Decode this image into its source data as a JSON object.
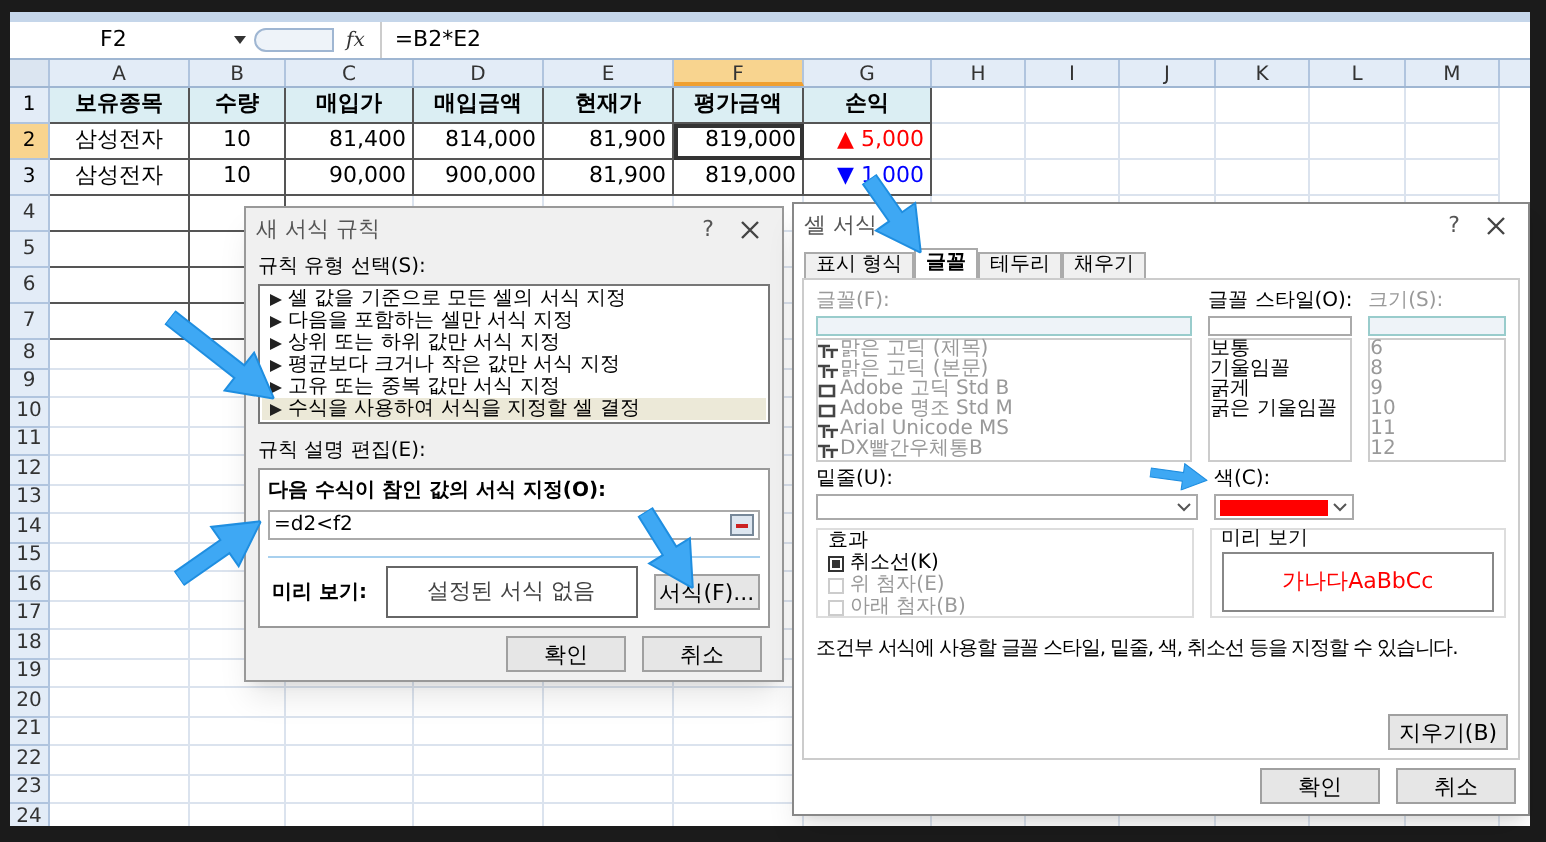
{
  "name_box": "F2",
  "function_label": "fx",
  "formula": "=B2*E2",
  "columns": [
    {
      "label": "A",
      "selected": false
    },
    {
      "label": "B",
      "selected": false
    },
    {
      "label": "C",
      "selected": false
    },
    {
      "label": "D",
      "selected": false
    },
    {
      "label": "E",
      "selected": false
    },
    {
      "label": "F",
      "selected": true
    },
    {
      "label": "G",
      "selected": false
    },
    {
      "label": "H",
      "selected": false
    },
    {
      "label": "I",
      "selected": false
    },
    {
      "label": "J",
      "selected": false
    },
    {
      "label": "K",
      "selected": false
    },
    {
      "label": "L",
      "selected": false
    },
    {
      "label": "M",
      "selected": false
    }
  ],
  "rows": [
    {
      "label": "1",
      "selected": false,
      "cells": [
        {
          "text": "보유종목",
          "kind": "header"
        },
        {
          "text": "수량",
          "kind": "header"
        },
        {
          "text": "매입가",
          "kind": "header"
        },
        {
          "text": "매입금액",
          "kind": "header"
        },
        {
          "text": "현재가",
          "kind": "header"
        },
        {
          "text": "평가금액",
          "kind": "header"
        },
        {
          "text": "손익",
          "kind": "header"
        }
      ]
    },
    {
      "label": "2",
      "selected": true,
      "cells": [
        {
          "text": "삼성전자",
          "kind": "text"
        },
        {
          "text": "10",
          "kind": "text"
        },
        {
          "text": "81,400",
          "kind": "number"
        },
        {
          "text": "814,000",
          "kind": "number"
        },
        {
          "text": "81,900",
          "kind": "number"
        },
        {
          "text": "819,000",
          "kind": "number",
          "selected": true
        },
        {
          "text": "▲ 5,000",
          "kind": "change",
          "color": "#ff0000"
        }
      ]
    },
    {
      "label": "3",
      "selected": false,
      "cells": [
        {
          "text": "삼성전자",
          "kind": "text"
        },
        {
          "text": "10",
          "kind": "text"
        },
        {
          "text": "90,000",
          "kind": "number"
        },
        {
          "text": "900,000",
          "kind": "number"
        },
        {
          "text": "81,900",
          "kind": "number"
        },
        {
          "text": "819,000",
          "kind": "number",
          "selected": false
        },
        {
          "text": "▼ 1,000",
          "kind": "change",
          "color": "#0000ff"
        }
      ]
    }
  ],
  "empty_rows": [
    "4",
    "5",
    "6",
    "7",
    "8",
    "9",
    "10",
    "11",
    "12",
    "13",
    "14",
    "15",
    "16",
    "17",
    "18",
    "19",
    "20",
    "21",
    "22",
    "23",
    "24"
  ],
  "rule_dialog": {
    "title": "새 서식 규칙",
    "help": "?",
    "type_label": "규칙 유형 선택(S):",
    "rule_types": [
      {
        "label": "셀 값을 기준으로 모든 셀의 서식 지정",
        "selected": false
      },
      {
        "label": "다음을 포함하는 셀만 서식 지정",
        "selected": false
      },
      {
        "label": "상위 또는 하위 값만 서식 지정",
        "selected": false
      },
      {
        "label": "평균보다 크거나 작은 값만 서식 지정",
        "selected": false
      },
      {
        "label": "고유 또는 중복 값만 서식 지정",
        "selected": false
      },
      {
        "label": "수식을 사용하여 서식을 지정할 셀 결정",
        "selected": true
      }
    ],
    "edit_label": "규칙 설명 편집(E):",
    "formula_label": "다음 수식이 참인 값의 서식 지정(O):",
    "formula_value": "=d2<f2",
    "preview_label": "미리 보기:",
    "preview_text": "설정된 서식 없음",
    "format_button": "서식(F)...",
    "ok": "확인",
    "cancel": "취소"
  },
  "format_dialog": {
    "title": "셀 서식",
    "help": "?",
    "tabs": [
      {
        "label": "표시 형식",
        "selected": false
      },
      {
        "label": "글꼴",
        "selected": true
      },
      {
        "label": "테두리",
        "selected": false
      },
      {
        "label": "채우기",
        "selected": false
      }
    ],
    "font_label": "글꼴(F):",
    "fonts": [
      {
        "name": "맑은 고딕 (제목)",
        "kind": "truetype"
      },
      {
        "name": "맑은 고딕 (본문)",
        "kind": "truetype"
      },
      {
        "name": "Adobe 고딕 Std B",
        "kind": "opentype"
      },
      {
        "name": "Adobe 명조 Std M",
        "kind": "opentype"
      },
      {
        "name": "Arial Unicode MS",
        "kind": "truetype"
      },
      {
        "name": "DX빨간우체통B",
        "kind": "truetype"
      }
    ],
    "style_label": "글꼴 스타일(O):",
    "styles": [
      "보통",
      "기울임꼴",
      "굵게",
      "굵은 기울임꼴"
    ],
    "size_label": "크기(S):",
    "sizes": [
      "6",
      "8",
      "9",
      "10",
      "11",
      "12"
    ],
    "underline_label": "밑줄(U):",
    "color_label": "색(C):",
    "color": "#ff0000",
    "effects_label": "효과",
    "effects": [
      {
        "label": "취소선(K)",
        "checked": true,
        "disabled": false
      },
      {
        "label": "위 첨자(E)",
        "checked": false,
        "disabled": true
      },
      {
        "label": "아래 첨자(B)",
        "checked": false,
        "disabled": true
      }
    ],
    "preview_label": "미리 보기",
    "preview_text": "가나다AaBbCc",
    "description": "조건부 서식에 사용할 글꼴 스타일, 밑줄, 색, 취소선 등을 지정할 수 있습니다.",
    "clear_button": "지우기(B)",
    "ok": "확인",
    "cancel": "취소"
  }
}
